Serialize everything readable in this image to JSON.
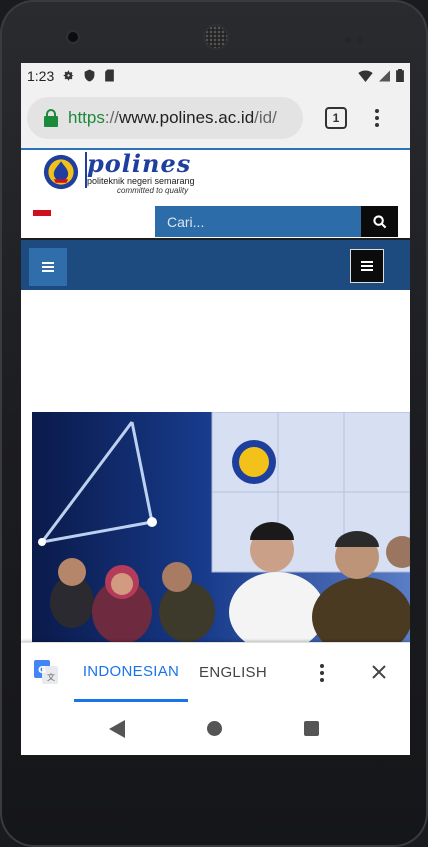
{
  "status_bar": {
    "time": "1:23",
    "left_icons": [
      "gear-icon",
      "shield-icon",
      "sd-card-icon"
    ],
    "right_icons": [
      "wifi-icon",
      "signal-icon",
      "battery-icon"
    ]
  },
  "browser": {
    "url_scheme": "https",
    "url_sep": "://",
    "url_host": "www.polines.ac.id",
    "url_path": "/id/",
    "tab_count": "1"
  },
  "site": {
    "logo_word": "polines",
    "logo_sub": "politeknik negeri semarang",
    "logo_tag": "committed to quality",
    "search_placeholder": "Cari...",
    "colors": {
      "nav_blue": "#1d4a7f",
      "search_blue": "#2b6ca9",
      "flag_red": "#d0101d"
    }
  },
  "translate_bar": {
    "active_lang": "INDONESIAN",
    "other_lang": "ENGLISH"
  }
}
